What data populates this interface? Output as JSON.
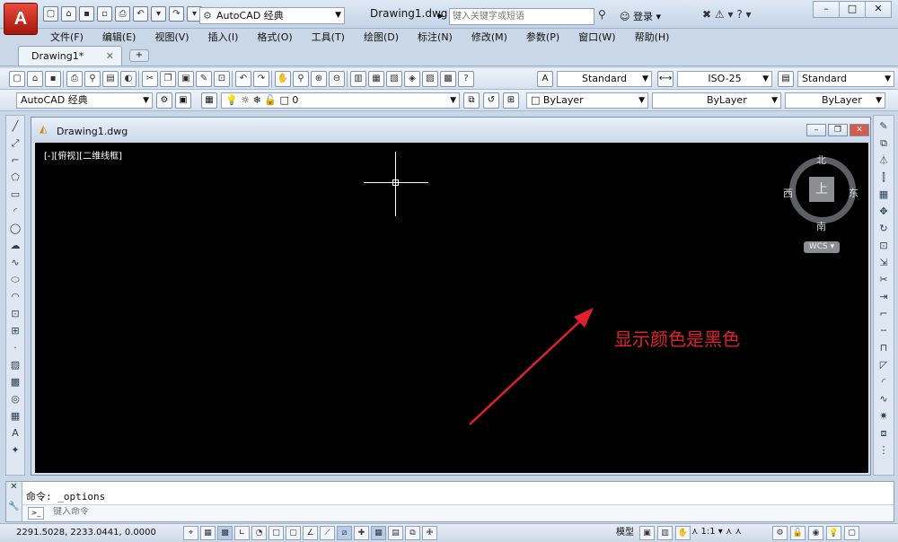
{
  "app": {
    "logo_letter": "A",
    "workspace": "AutoCAD 经典",
    "document_title": "Drawing1.dwg"
  },
  "search": {
    "placeholder": "键入关键字或短语"
  },
  "user": {
    "login_label": "登录"
  },
  "menu": [
    "文件(F)",
    "编辑(E)",
    "视图(V)",
    "插入(I)",
    "格式(O)",
    "工具(T)",
    "绘图(D)",
    "标注(N)",
    "修改(M)",
    "参数(P)",
    "窗口(W)",
    "帮助(H)"
  ],
  "tabs": [
    {
      "label": "Drawing1*"
    }
  ],
  "styles": {
    "text_style": "Standard",
    "dim_style": "ISO-25",
    "table_style": "Standard"
  },
  "layers": {
    "workspace": "AutoCAD 经典",
    "current_layer": "0",
    "color": "ByLayer",
    "linetype": "ByLayer",
    "lineweight": "ByLayer"
  },
  "drawing_window": {
    "title": "Drawing1.dwg",
    "viewport_label": "[-][俯视][二维线框]"
  },
  "viewcube": {
    "north": "北",
    "south": "南",
    "east": "东",
    "west": "西",
    "face": "上",
    "wcs": "WCS"
  },
  "annotation": {
    "text": "显示颜色是黑色",
    "color": "#e0202a"
  },
  "command": {
    "history": "命令: _options",
    "placeholder": "键入命令"
  },
  "status": {
    "coords": "2291.5028, 2233.0441, 0.0000",
    "model": "模型",
    "scale": "1:1"
  },
  "colors": {
    "canvas": "#000000",
    "ui_bg": "#c9d7e6",
    "logo": "#c8281c"
  }
}
